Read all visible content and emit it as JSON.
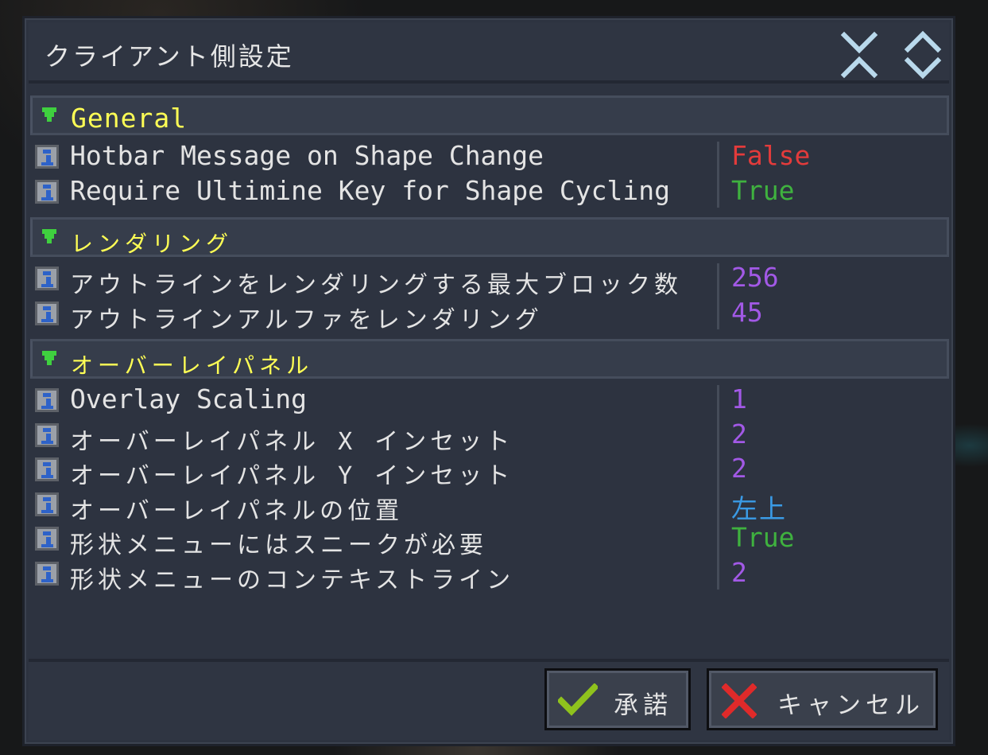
{
  "window": {
    "title": "クライアント側設定",
    "collapse_all_icon": "collapse-all-icon",
    "expand_all_icon": "expand-all-icon"
  },
  "colors": {
    "section_label": "#ffff55",
    "false": "#e33b3b",
    "true": "#3fb23f",
    "number": "#a259e6",
    "enum": "#3a9be6"
  },
  "sections": [
    {
      "label": "General",
      "rows": [
        {
          "name": "Hotbar Message on Shape Change",
          "value": "False"
        },
        {
          "name": "Require Ultimine Key for Shape Cycling",
          "value": "True"
        }
      ]
    },
    {
      "label": "レンダリング",
      "rows": [
        {
          "name": "アウトラインをレンダリングする最大ブロック数",
          "value": "256"
        },
        {
          "name": "アウトラインアルファをレンダリング",
          "value": "45"
        }
      ]
    },
    {
      "label": "オーバーレイパネル",
      "rows": [
        {
          "name": "Overlay Scaling",
          "value": "1"
        },
        {
          "name": "オーバーレイパネル X インセット",
          "value": "2"
        },
        {
          "name": "オーバーレイパネル Y インセット",
          "value": "2"
        },
        {
          "name": "オーバーレイパネルの位置",
          "value": "左上"
        },
        {
          "name": "形状メニューにはスニークが必要",
          "value": "True"
        },
        {
          "name": "形状メニューのコンテキストライン",
          "value": "2"
        }
      ]
    }
  ],
  "footer": {
    "accept_label": "承諾",
    "cancel_label": "キャンセル"
  }
}
